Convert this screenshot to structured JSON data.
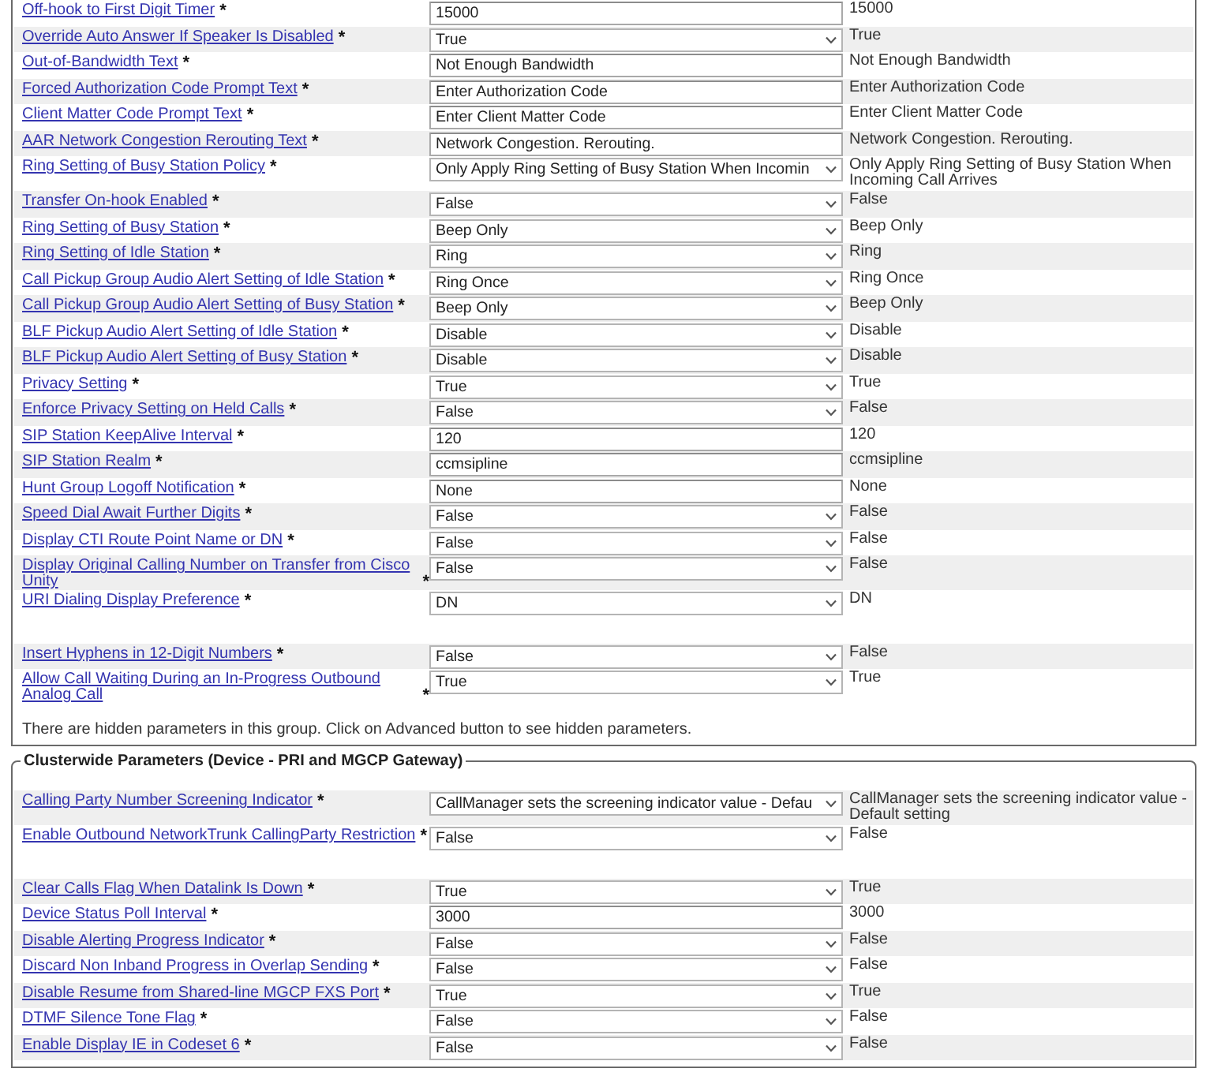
{
  "panels": [
    {
      "rows": [
        {
          "label": "Off-hook to First Digit Timer",
          "required_mark": "*",
          "kind": "text",
          "value": "15000",
          "default": "15000",
          "shaded": false
        },
        {
          "label": "Override Auto Answer If Speaker Is Disabled",
          "required_mark": "*",
          "kind": "select",
          "value": "True",
          "default": "True",
          "shaded": true
        },
        {
          "label": "Out-of-Bandwidth Text",
          "required_mark": "*",
          "kind": "text",
          "value": "Not Enough Bandwidth",
          "default": "Not Enough Bandwidth",
          "shaded": false
        },
        {
          "label": "Forced Authorization Code Prompt Text",
          "required_mark": "*",
          "kind": "text",
          "value": "Enter Authorization Code",
          "default": "Enter Authorization Code",
          "shaded": true
        },
        {
          "label": "Client Matter Code Prompt Text",
          "required_mark": "*",
          "kind": "text",
          "value": "Enter Client Matter Code",
          "default": "Enter Client Matter Code",
          "shaded": false
        },
        {
          "label": "AAR Network Congestion Rerouting Text",
          "required_mark": "*",
          "kind": "text",
          "value": "Network Congestion. Rerouting.",
          "default": "Network Congestion. Rerouting.",
          "shaded": true
        },
        {
          "label": "Ring Setting of Busy Station Policy",
          "required_mark": "*",
          "kind": "select",
          "value": "Only Apply Ring Setting of Busy Station When Incomin",
          "default": "Only Apply Ring Setting of Busy Station When Incoming Call Arrives",
          "shaded": false
        },
        {
          "label": "Transfer On-hook Enabled",
          "required_mark": "*",
          "kind": "select",
          "value": "False",
          "default": "False",
          "shaded": true
        },
        {
          "label": "Ring Setting of Busy Station",
          "required_mark": "*",
          "kind": "select",
          "value": "Beep Only",
          "default": "Beep Only",
          "shaded": false
        },
        {
          "label": "Ring Setting of Idle Station",
          "required_mark": "*",
          "kind": "select",
          "value": "Ring",
          "default": "Ring",
          "shaded": true
        },
        {
          "label": "Call Pickup Group Audio Alert Setting of Idle Station",
          "required_mark": "*",
          "kind": "select",
          "value": "Ring Once",
          "default": "Ring Once",
          "shaded": false
        },
        {
          "label": "Call Pickup Group Audio Alert Setting of Busy Station",
          "required_mark": "*",
          "kind": "select",
          "value": "Beep Only",
          "default": "Beep Only",
          "shaded": true
        },
        {
          "label": "BLF Pickup Audio Alert Setting of Idle Station",
          "required_mark": "*",
          "kind": "select",
          "value": "Disable",
          "default": "Disable",
          "shaded": false
        },
        {
          "label": "BLF Pickup Audio Alert Setting of Busy Station",
          "required_mark": "*",
          "kind": "select",
          "value": "Disable",
          "default": "Disable",
          "shaded": true
        },
        {
          "label": "Privacy Setting",
          "required_mark": "*",
          "kind": "select",
          "value": "True",
          "default": "True",
          "shaded": false
        },
        {
          "label": "Enforce Privacy Setting on Held Calls",
          "required_mark": "*",
          "kind": "select",
          "value": "False",
          "default": "False",
          "shaded": true
        },
        {
          "label": "SIP Station KeepAlive Interval",
          "required_mark": "*",
          "kind": "text",
          "value": "120",
          "default": "120",
          "shaded": false
        },
        {
          "label": "SIP Station Realm",
          "required_mark": "*",
          "kind": "text",
          "value": "ccmsipline",
          "default": "ccmsipline",
          "shaded": true
        },
        {
          "label": "Hunt Group Logoff Notification",
          "required_mark": "*",
          "kind": "text",
          "value": "None",
          "default": "None",
          "shaded": false
        },
        {
          "label": "Speed Dial Await Further Digits",
          "required_mark": "*",
          "kind": "select",
          "value": "False",
          "default": "False",
          "shaded": true
        },
        {
          "label": "Display CTI Route Point Name or DN",
          "required_mark": "*",
          "kind": "select",
          "value": "False",
          "default": "False",
          "shaded": false
        },
        {
          "label": "Display Original Calling Number on Transfer from Cisco Unity",
          "required_mark": "*",
          "kind": "select",
          "value": "False",
          "default": "False",
          "shaded": true
        },
        {
          "label": "URI Dialing Display Preference",
          "required_mark": "*",
          "kind": "select",
          "value": "DN",
          "default": "DN",
          "shaded": false
        },
        {
          "kind": "blank"
        },
        {
          "label": "Insert Hyphens in 12-Digit Numbers",
          "required_mark": "*",
          "kind": "select",
          "value": "False",
          "default": "False",
          "shaded": true
        },
        {
          "label": "Allow Call Waiting During an In-Progress Outbound Analog Call",
          "required_mark": "*",
          "kind": "select",
          "value": "True",
          "default": "True",
          "shaded": false
        }
      ],
      "note": "There are hidden parameters in this group. Click on Advanced button to see hidden parameters."
    },
    {
      "title": "Clusterwide Parameters (Device - PRI and MGCP Gateway)",
      "rows": [
        {
          "label": "Calling Party Number Screening Indicator",
          "required_mark": "*",
          "kind": "select",
          "value": "CallManager sets the screening indicator value - Defau",
          "default": "CallManager sets the screening indicator value - Default setting",
          "shaded": true
        },
        {
          "label": "Enable Outbound NetworkTrunk CallingParty Restriction",
          "required_mark": "*",
          "kind": "select",
          "value": "False",
          "default": "False",
          "shaded": false
        },
        {
          "kind": "blank"
        },
        {
          "label": "Clear Calls Flag When Datalink Is Down",
          "required_mark": "*",
          "kind": "select",
          "value": "True",
          "default": "True",
          "shaded": true
        },
        {
          "label": "Device Status Poll Interval",
          "required_mark": "*",
          "kind": "text",
          "value": "3000",
          "default": "3000",
          "shaded": false
        },
        {
          "label": "Disable Alerting Progress Indicator",
          "required_mark": "*",
          "kind": "select",
          "value": "False",
          "default": "False",
          "shaded": true
        },
        {
          "label": "Discard Non Inband Progress in Overlap Sending",
          "required_mark": "*",
          "kind": "select",
          "value": "False",
          "default": "False",
          "shaded": false
        },
        {
          "label": "Disable Resume from Shared-line MGCP FXS Port",
          "required_mark": "*",
          "kind": "select",
          "value": "True",
          "default": "True",
          "shaded": true
        },
        {
          "label": "DTMF Silence Tone Flag",
          "required_mark": "*",
          "kind": "select",
          "value": "False",
          "default": "False",
          "shaded": false
        },
        {
          "label": "Enable Display IE in Codeset 6",
          "required_mark": "*",
          "kind": "select",
          "value": "False",
          "default": "False",
          "shaded": true
        }
      ]
    }
  ]
}
